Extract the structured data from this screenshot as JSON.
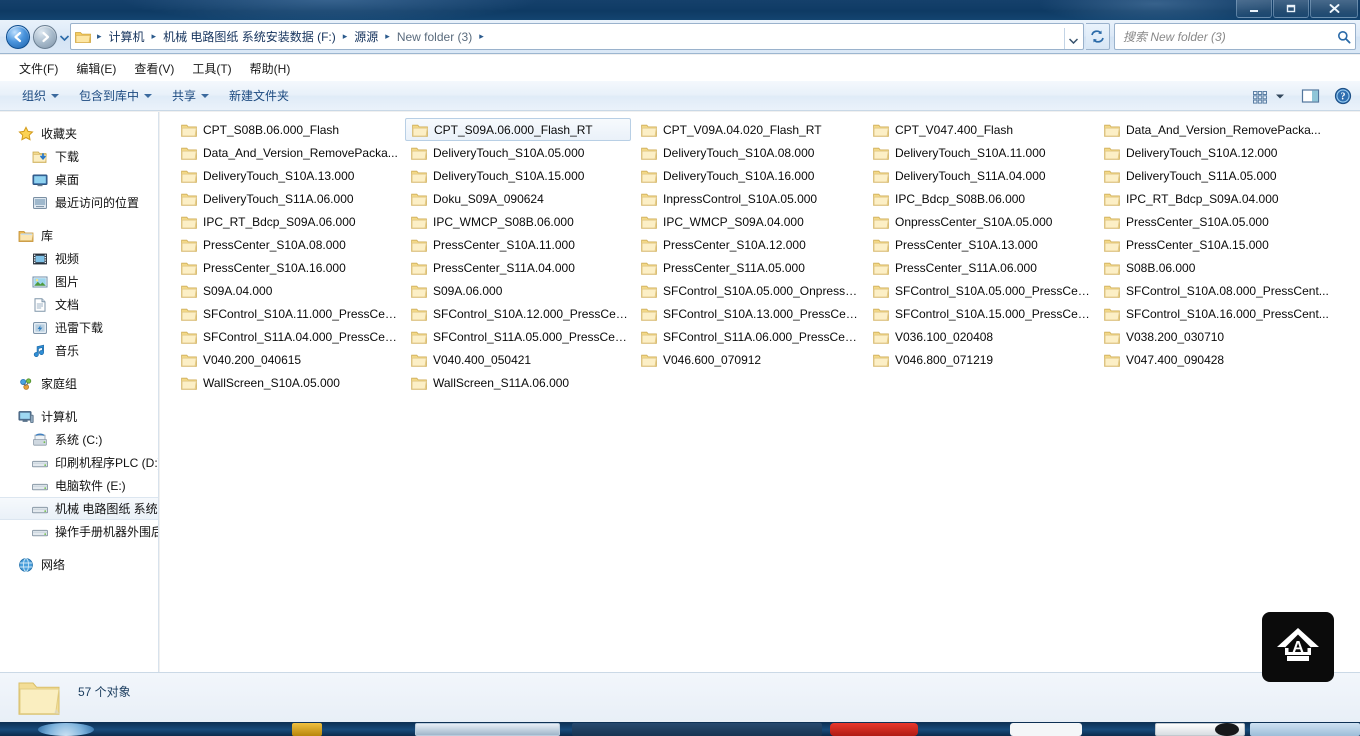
{
  "window": {
    "title": "",
    "buttons": {
      "minimize": "minimize-button",
      "maximize": "maximize-button",
      "close": "close-button"
    }
  },
  "addressbar": {
    "back_tooltip": "后退",
    "forward_tooltip": "前进",
    "crumbs": [
      "计算机",
      "机械 电路图纸 系统安装数据 (F:)",
      "源源",
      "New folder (3)"
    ],
    "separator": "▸"
  },
  "search": {
    "placeholder": "搜索 New folder (3)",
    "icon": "search-icon"
  },
  "menubar": {
    "items": [
      "文件(F)",
      "编辑(E)",
      "查看(V)",
      "工具(T)",
      "帮助(H)"
    ]
  },
  "commandbar": {
    "items": [
      {
        "label": "组织",
        "has_caret": true
      },
      {
        "label": "包含到库中",
        "has_caret": true
      },
      {
        "label": "共享",
        "has_caret": true
      },
      {
        "label": "新建文件夹",
        "has_caret": false
      }
    ],
    "right_icons": [
      "views-icon",
      "views-caret-icon",
      "preview-pane-icon",
      "help-icon"
    ]
  },
  "sidebar": {
    "groups": [
      {
        "header": {
          "label": "收藏夹",
          "icon": "star-icon"
        },
        "items": [
          {
            "label": "下载",
            "icon": "downloads-icon"
          },
          {
            "label": "桌面",
            "icon": "desktop-icon"
          },
          {
            "label": "最近访问的位置",
            "icon": "recent-places-icon"
          }
        ]
      },
      {
        "header": {
          "label": "库",
          "icon": "library-icon"
        },
        "items": [
          {
            "label": "视频",
            "icon": "videos-icon"
          },
          {
            "label": "图片",
            "icon": "pictures-icon"
          },
          {
            "label": "文档",
            "icon": "documents-icon"
          },
          {
            "label": "迅雷下载",
            "icon": "thunder-downloads-icon"
          },
          {
            "label": "音乐",
            "icon": "music-icon"
          }
        ]
      },
      {
        "header": {
          "label": "家庭组",
          "icon": "homegroup-icon"
        },
        "items": []
      },
      {
        "header": {
          "label": "计算机",
          "icon": "computer-icon"
        },
        "items": [
          {
            "label": "系统 (C:)",
            "icon": "system-drive-icon",
            "selected": false
          },
          {
            "label": "印刷机程序PLC (D:)",
            "icon": "drive-icon",
            "selected": false
          },
          {
            "label": "电脑软件 (E:)",
            "icon": "drive-icon",
            "selected": false
          },
          {
            "label": "机械 电路图纸 系统",
            "icon": "drive-icon",
            "selected": true
          },
          {
            "label": "操作手册机器外围后",
            "icon": "drive-icon",
            "selected": false
          }
        ]
      },
      {
        "header": {
          "label": "网络",
          "icon": "network-icon"
        },
        "items": []
      }
    ]
  },
  "filelist": {
    "columns": [
      {
        "items": [
          {
            "name": "CPT_S08B.06.000_Flash",
            "selected": false
          },
          {
            "name": "Data_And_Version_RemovePacka...",
            "selected": false
          },
          {
            "name": "DeliveryTouch_S10A.13.000",
            "selected": false
          },
          {
            "name": "DeliveryTouch_S11A.06.000",
            "selected": false
          },
          {
            "name": "IPC_RT_Bdcp_S09A.06.000",
            "selected": false
          },
          {
            "name": "PressCenter_S10A.08.000",
            "selected": false
          },
          {
            "name": "PressCenter_S10A.16.000",
            "selected": false
          },
          {
            "name": "S09A.04.000",
            "selected": false
          },
          {
            "name": "SFControl_S10A.11.000_PressCent...",
            "selected": false
          },
          {
            "name": "SFControl_S11A.04.000_PressCent...",
            "selected": false
          },
          {
            "name": "V040.200_040615",
            "selected": false
          },
          {
            "name": "WallScreen_S10A.05.000",
            "selected": false
          }
        ]
      },
      {
        "items": [
          {
            "name": "CPT_S09A.06.000_Flash_RT",
            "selected": true
          },
          {
            "name": "DeliveryTouch_S10A.05.000",
            "selected": false
          },
          {
            "name": "DeliveryTouch_S10A.15.000",
            "selected": false
          },
          {
            "name": "Doku_S09A_090624",
            "selected": false
          },
          {
            "name": "IPC_WMCP_S08B.06.000",
            "selected": false
          },
          {
            "name": "PressCenter_S10A.11.000",
            "selected": false
          },
          {
            "name": "PressCenter_S11A.04.000",
            "selected": false
          },
          {
            "name": "S09A.06.000",
            "selected": false
          },
          {
            "name": "SFControl_S10A.12.000_PressCent...",
            "selected": false
          },
          {
            "name": "SFControl_S11A.05.000_PressCent...",
            "selected": false
          },
          {
            "name": "V040.400_050421",
            "selected": false
          },
          {
            "name": "WallScreen_S11A.06.000",
            "selected": false
          }
        ]
      },
      {
        "items": [
          {
            "name": "CPT_V09A.04.020_Flash_RT",
            "selected": false
          },
          {
            "name": "DeliveryTouch_S10A.08.000",
            "selected": false
          },
          {
            "name": "DeliveryTouch_S10A.16.000",
            "selected": false
          },
          {
            "name": "InpressControl_S10A.05.000",
            "selected": false
          },
          {
            "name": "IPC_WMCP_S09A.04.000",
            "selected": false
          },
          {
            "name": "PressCenter_S10A.12.000",
            "selected": false
          },
          {
            "name": "PressCenter_S11A.05.000",
            "selected": false
          },
          {
            "name": "SFControl_S10A.05.000_OnpressC...",
            "selected": false
          },
          {
            "name": "SFControl_S10A.13.000_PressCent...",
            "selected": false
          },
          {
            "name": "SFControl_S11A.06.000_PressCent...",
            "selected": false
          },
          {
            "name": "V046.600_070912",
            "selected": false
          }
        ]
      },
      {
        "items": [
          {
            "name": "CPT_V047.400_Flash",
            "selected": false
          },
          {
            "name": "DeliveryTouch_S10A.11.000",
            "selected": false
          },
          {
            "name": "DeliveryTouch_S11A.04.000",
            "selected": false
          },
          {
            "name": "IPC_Bdcp_S08B.06.000",
            "selected": false
          },
          {
            "name": "OnpressCenter_S10A.05.000",
            "selected": false
          },
          {
            "name": "PressCenter_S10A.13.000",
            "selected": false
          },
          {
            "name": "PressCenter_S11A.06.000",
            "selected": false
          },
          {
            "name": "SFControl_S10A.05.000_PressCent...",
            "selected": false
          },
          {
            "name": "SFControl_S10A.15.000_PressCent...",
            "selected": false
          },
          {
            "name": "V036.100_020408",
            "selected": false
          },
          {
            "name": "V046.800_071219",
            "selected": false
          }
        ]
      },
      {
        "items": [
          {
            "name": "Data_And_Version_RemovePacka...",
            "selected": false
          },
          {
            "name": "DeliveryTouch_S10A.12.000",
            "selected": false
          },
          {
            "name": "DeliveryTouch_S11A.05.000",
            "selected": false
          },
          {
            "name": "IPC_RT_Bdcp_S09A.04.000",
            "selected": false
          },
          {
            "name": "PressCenter_S10A.05.000",
            "selected": false
          },
          {
            "name": "PressCenter_S10A.15.000",
            "selected": false
          },
          {
            "name": "S08B.06.000",
            "selected": false
          },
          {
            "name": "SFControl_S10A.08.000_PressCent...",
            "selected": false
          },
          {
            "name": "SFControl_S10A.16.000_PressCent...",
            "selected": false
          },
          {
            "name": "V038.200_030710",
            "selected": false
          },
          {
            "name": "V047.400_090428",
            "selected": false
          }
        ]
      }
    ]
  },
  "statusbar": {
    "text": "57 个对象",
    "icon": "folder-icon"
  },
  "watermark": {
    "glyph": "A",
    "icon": "app-watermark-icon"
  },
  "colors": {
    "titlebar": "#0e3a63",
    "accent": "#1c4a80",
    "folder_yellow": "#fdd97b",
    "selection_border": "#b8cfe5"
  }
}
